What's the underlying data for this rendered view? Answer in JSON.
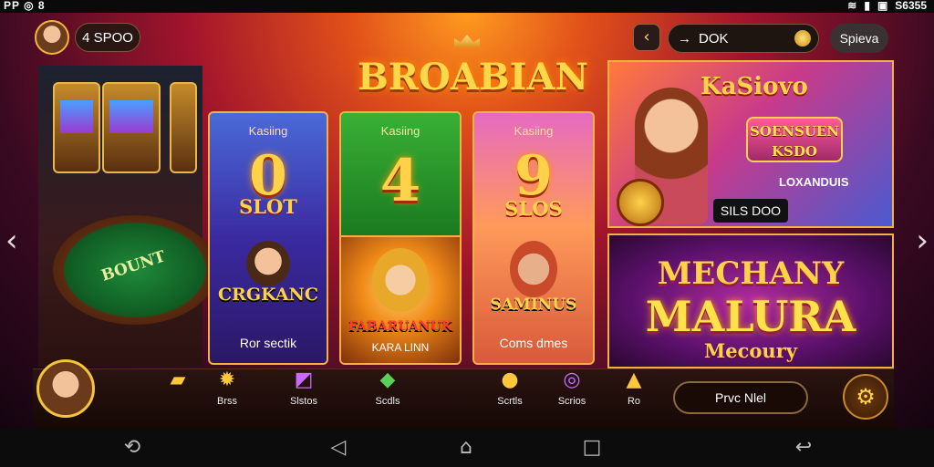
{
  "status_bar": {
    "left": "PP  ◎  8",
    "right_icons": [
      "wifi-icon",
      "signal-icon",
      "notification-icon"
    ],
    "right_text": "S6355"
  },
  "header": {
    "coins": "4 SPOO",
    "brand_title": "BROABIAN",
    "search_value": "DOK",
    "action_label": "Spieva"
  },
  "background": {
    "table_label": "BOUNT"
  },
  "cards": [
    {
      "top_label": "Kasiing",
      "number": "0",
      "sub_label": "SLOT",
      "char_title": "CRGKANC",
      "bottom_label": "Ror sectik"
    },
    {
      "top_label": "Kasiing",
      "number": "4",
      "char_title": "FABARUANUK",
      "bottom_label": "KARA LINN"
    },
    {
      "top_label": "Kasiing",
      "number": "9",
      "sub_label": "SLOS",
      "char_title": "SAMINUS",
      "bottom_label": "Coms dmes"
    }
  ],
  "promo_top": {
    "title": "KaSiovo",
    "sign_line1": "SOENSUEN",
    "sign_line2": "KSDO",
    "caption": "LOXANDUIS",
    "badge": "SILS DOO"
  },
  "promo_bottom": {
    "line1": "MECHANY",
    "line2": "MALURA",
    "line3": "Mecoury"
  },
  "toolbar": {
    "items": [
      {
        "label": "",
        "icon": "cards-icon"
      },
      {
        "label": "Brss",
        "icon": "coin-icon"
      },
      {
        "label": "Slstos",
        "icon": "gift-icon"
      },
      {
        "label": "Scdls",
        "icon": "ticket-icon"
      },
      {
        "label": "Scrtls",
        "icon": "trophy-icon"
      },
      {
        "label": "Scrios",
        "icon": "search-icon"
      },
      {
        "label": "Ro",
        "icon": "mask-icon"
      }
    ],
    "play_label": "Prvc Nlel"
  },
  "navbar": {
    "icons": [
      "rotate-icon",
      "back-icon",
      "home-icon",
      "recents-icon",
      "return-icon"
    ]
  },
  "colors": {
    "accent_gold": "#f4b040",
    "background_red": "#a3152c"
  }
}
